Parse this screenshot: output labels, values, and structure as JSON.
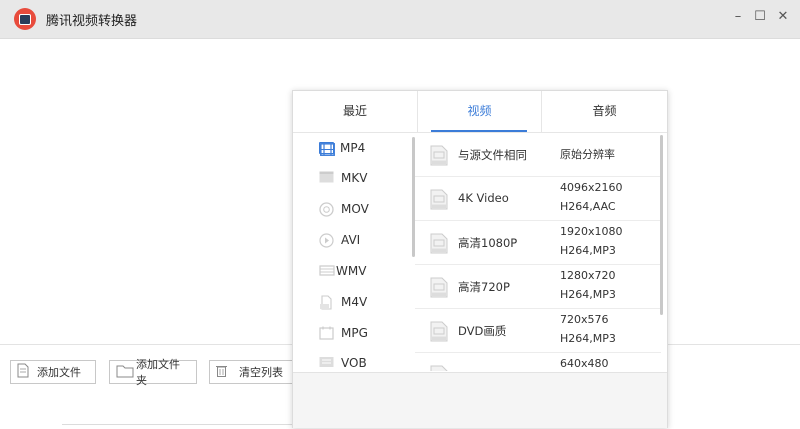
{
  "window": {
    "title": "腾讯视频转换器",
    "min": "–",
    "max": "☐",
    "close": "✕"
  },
  "toolbar": {
    "add_file": "添加文件",
    "add_folder": "添加文件夹",
    "clear_list": "清空列表"
  },
  "popup": {
    "tabs": [
      {
        "label": "最近",
        "active": false
      },
      {
        "label": "视频",
        "active": true
      },
      {
        "label": "音频",
        "active": false
      }
    ],
    "formats": [
      {
        "label": "MP4",
        "icon": "film-icon",
        "active": true
      },
      {
        "label": "MKV",
        "icon": "clapper-icon"
      },
      {
        "label": "MOV",
        "icon": "quicktime-icon"
      },
      {
        "label": "AVI",
        "icon": "play-circle-icon"
      },
      {
        "label": "WMV",
        "icon": "wmv-icon"
      },
      {
        "label": "M4V",
        "icon": "m4v-icon"
      },
      {
        "label": "MPG",
        "icon": "mpg-icon"
      },
      {
        "label": "VOB",
        "icon": "vob-icon"
      }
    ],
    "presets": [
      {
        "name": "与源文件相同",
        "res": "原始分辨率",
        "codec": "",
        "icon_tag": "SOURCE"
      },
      {
        "name": "4K Video",
        "res": "4096x2160",
        "codec": "H264,AAC",
        "icon_tag": "4K"
      },
      {
        "name": "高清1080P",
        "res": "1920x1080",
        "codec": "H264,MP3",
        "icon_tag": "1080P"
      },
      {
        "name": "高清720P",
        "res": "1280x720",
        "codec": "H264,MP3",
        "icon_tag": "720P"
      },
      {
        "name": "DVD画质",
        "res": "720x576",
        "codec": "H264,MP3",
        "icon_tag": "DVD"
      },
      {
        "name": "",
        "res": "640x480",
        "codec": "",
        "icon_tag": "480P"
      }
    ]
  },
  "colors": {
    "accent": "#3b7cd8",
    "app_icon": "#e84b3c"
  }
}
